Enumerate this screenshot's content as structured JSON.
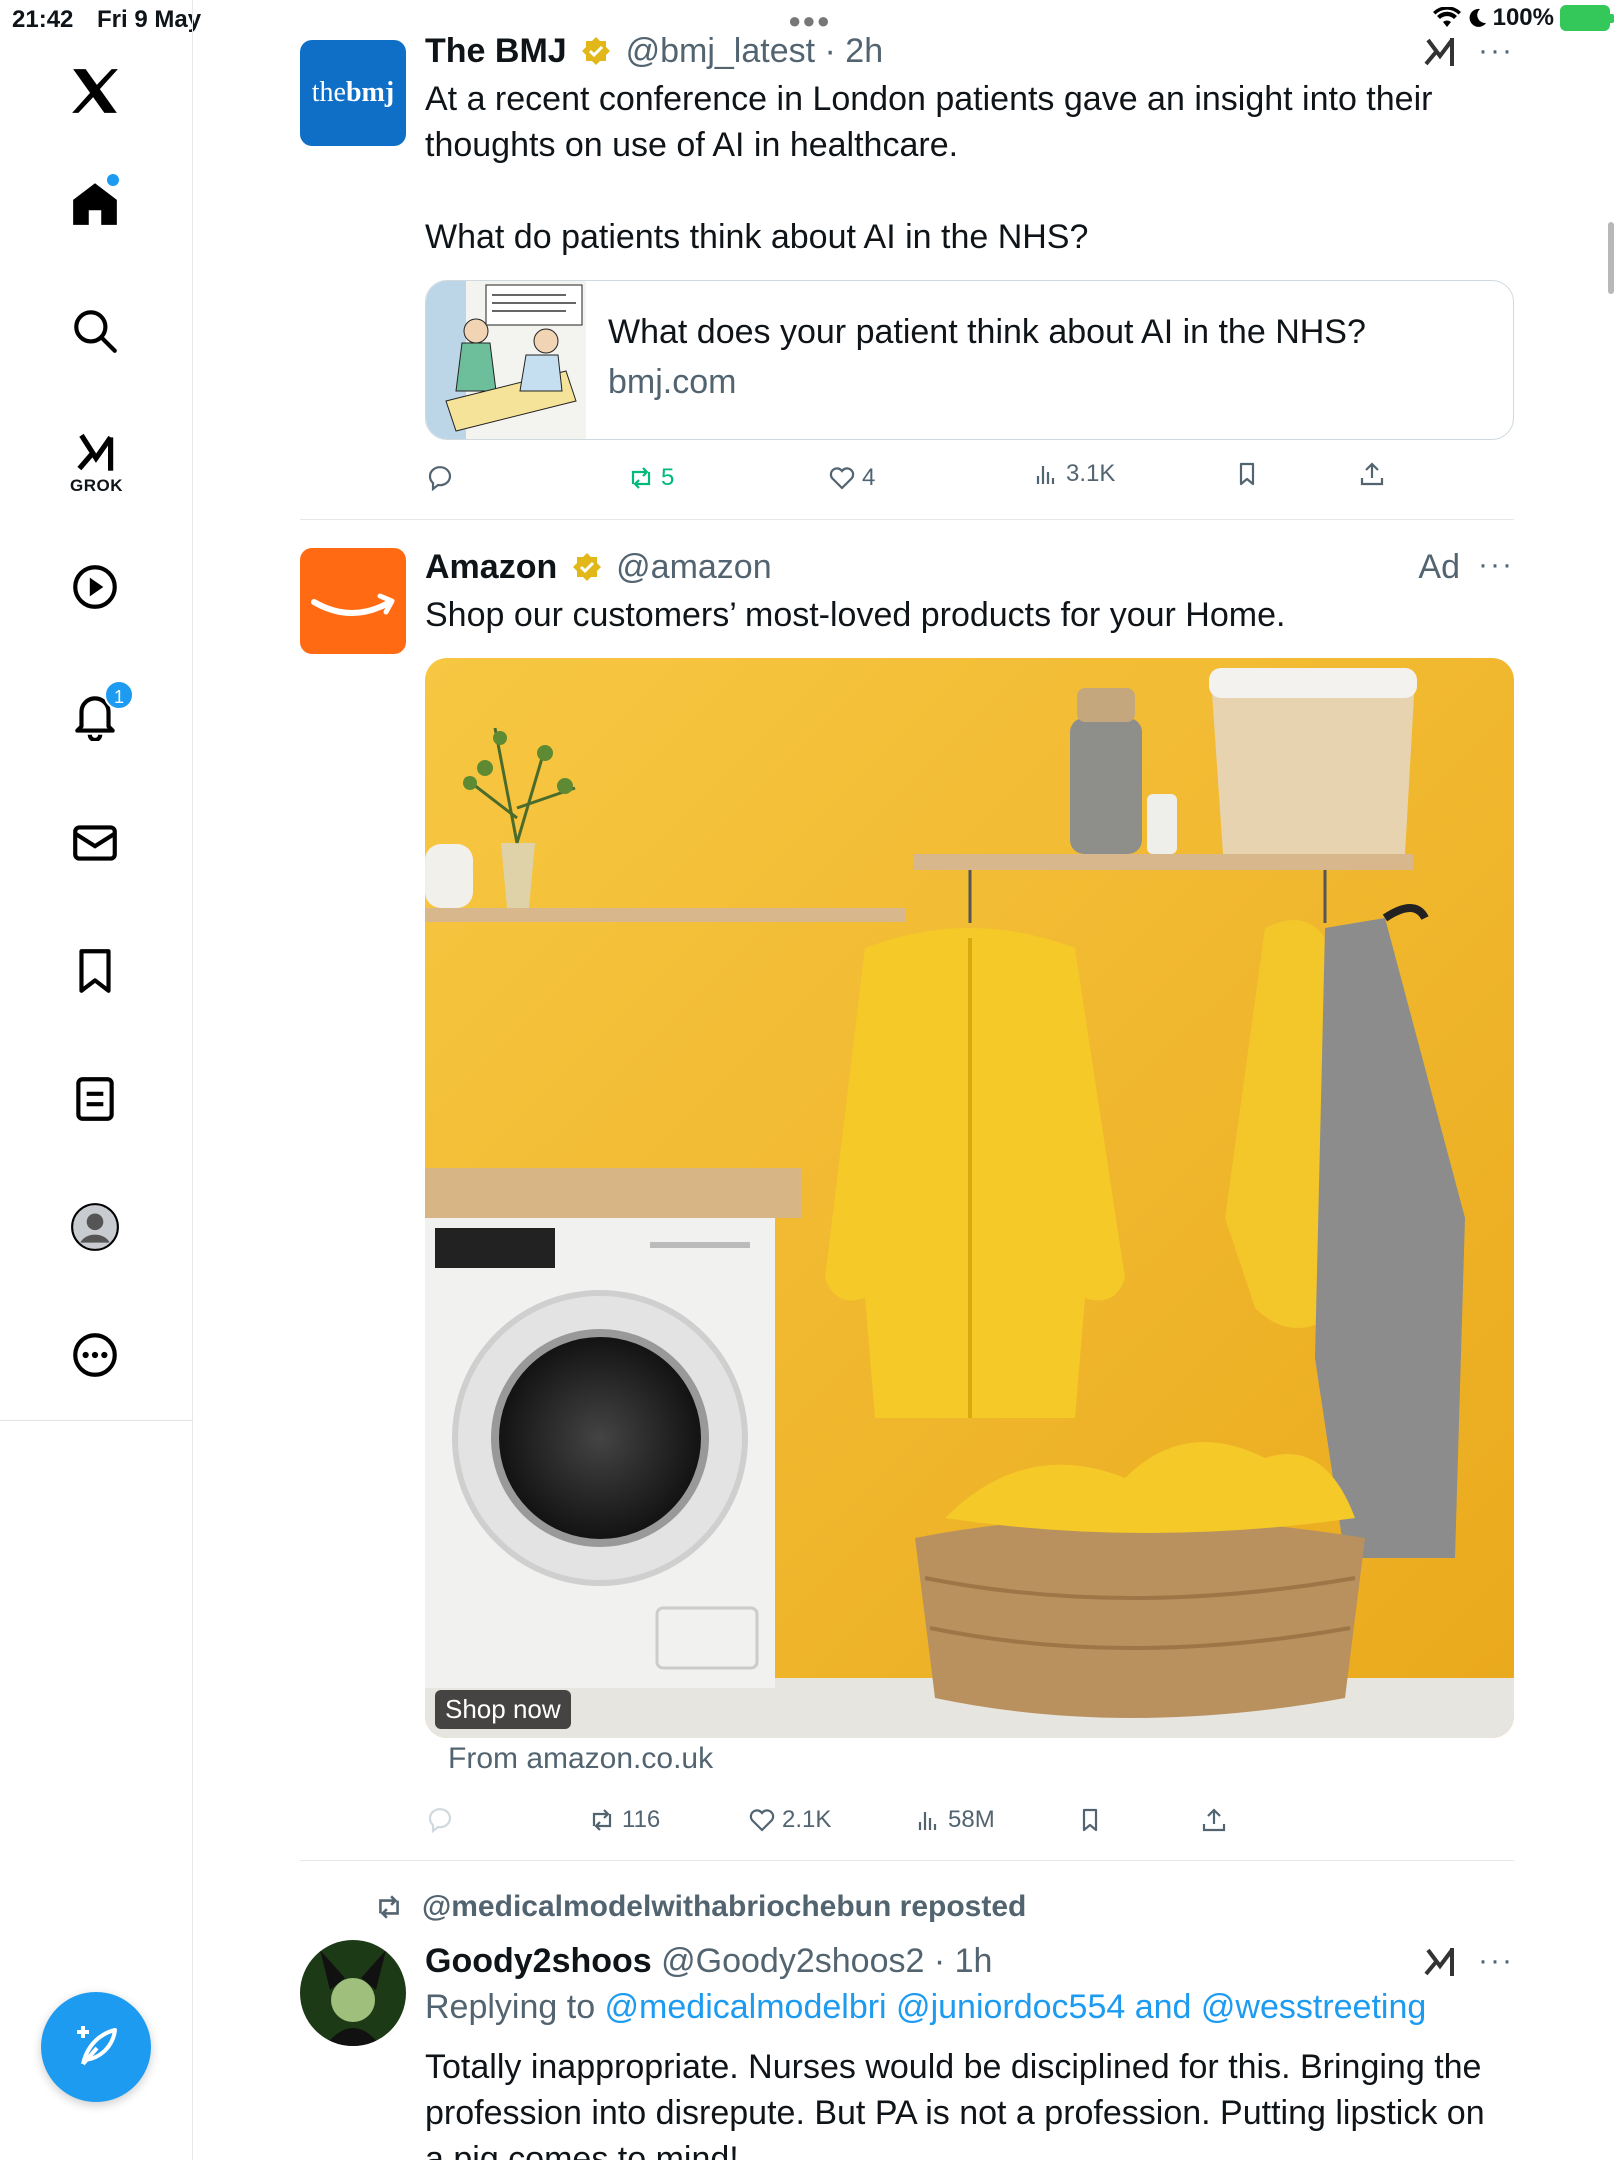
{
  "status_bar": {
    "time": "21:42",
    "date": "Fri 9 May",
    "battery": "100%"
  },
  "sidebar": {
    "grok_label": "GROK",
    "notifications_badge": "1"
  },
  "posts": [
    {
      "author": "The BMJ",
      "handle": "@bmj_latest",
      "time": "2h",
      "avatar_text_a": "the",
      "avatar_text_b": "bmj",
      "text_1": "At a recent conference in London patients gave an insight into their thoughts on use of AI in healthcare.",
      "text_2": "What do patients think about AI in the NHS?",
      "card": {
        "title": "What does your patient think about AI in the NHS?",
        "domain": "bmj.com"
      },
      "stats": {
        "replies": "",
        "reposts": "5",
        "likes": "4",
        "views": "3.1K"
      }
    },
    {
      "author": "Amazon",
      "handle": "@amazon",
      "ad_label": "Ad",
      "text": "Shop our customers’ most-loved products for your Home.",
      "cta": "Shop now",
      "source": "From amazon.co.uk",
      "stats": {
        "reposts": "116",
        "likes": "2.1K",
        "views": "58M"
      }
    },
    {
      "reposted_by": "@medicalmodelwithabriochebun reposted",
      "author": "Goody2shoos",
      "handle": "@Goody2shoos2",
      "time": "1h",
      "replying_prefix": "Replying to ",
      "replying_to": "@medicalmodelbri @juniordoc554 and @wesstreeting",
      "text": "Totally inappropriate. Nurses would be disciplined for this. Bringing the profession into disrepute. But PA is not a profession. Putting lipstick on a pig comes to mind!"
    }
  ],
  "colors": {
    "accent": "#1d9bf0",
    "repost_green": "#00ba7c",
    "bmj_blue": "#0f6fc6",
    "amazon_orange": "#ff6a13",
    "ad_yellow": "#f4c33a"
  }
}
